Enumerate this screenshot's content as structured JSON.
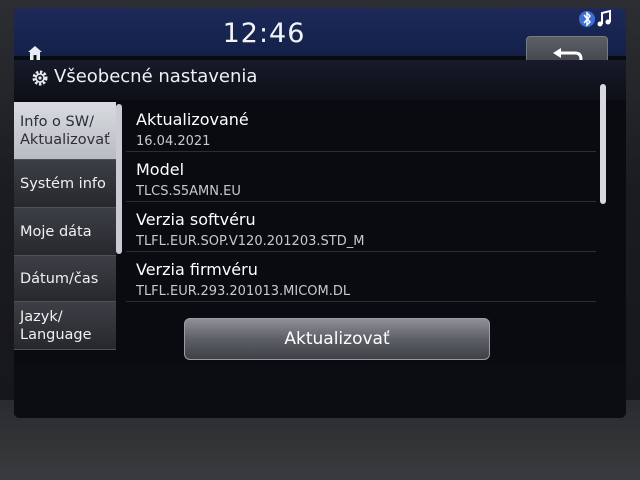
{
  "statusbar": {
    "time": "12:46",
    "home_icon": "home-icon",
    "bluetooth_icon": "bluetooth-music-icon",
    "back_icon": "back-arrow-icon"
  },
  "header": {
    "title": "Všeobecné nastavenia",
    "icon": "gear-icon"
  },
  "sidebar": {
    "items": [
      {
        "label_line1": "Info o SW/",
        "label_line2": "Aktualizovať",
        "active": true
      },
      {
        "label": "Systém info"
      },
      {
        "label": "Moje dáta"
      },
      {
        "label": "Dátum/čas"
      },
      {
        "label_line1": "Jazyk/",
        "label_line2": "Language"
      }
    ]
  },
  "main": {
    "rows": [
      {
        "label": "Aktualizované",
        "value": "16.04.2021"
      },
      {
        "label": "Model",
        "value": "TLCS.S5AMN.EU"
      },
      {
        "label": "Verzia softvéru",
        "value": "TLFL.EUR.SOP.V120.201203.STD_M"
      },
      {
        "label": "Verzia firmvéru",
        "value": "TLFL.EUR.293.201013.MICOM.DL"
      }
    ],
    "update_button": "Aktualizovať"
  },
  "colors": {
    "statusbar": "#1d2a5a",
    "active_tab": "#d8dbe0",
    "background": "#0a0b10"
  }
}
